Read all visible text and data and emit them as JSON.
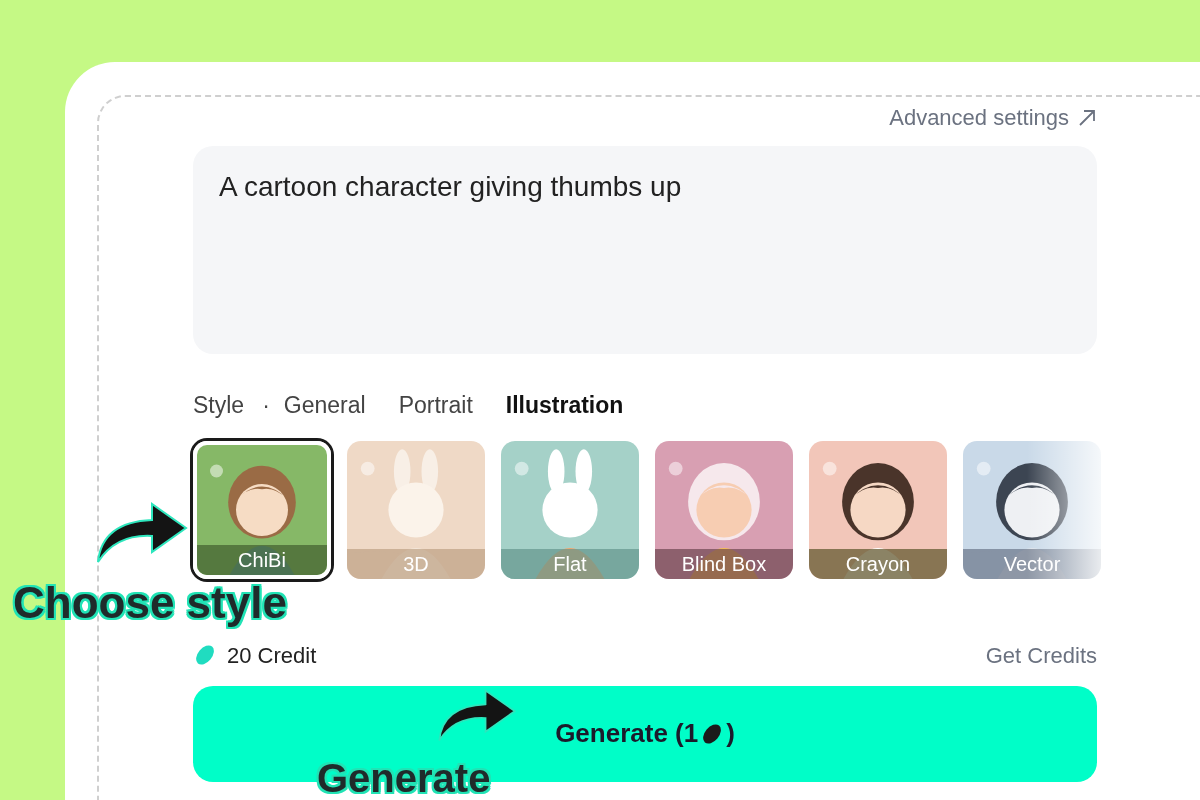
{
  "advanced_settings": {
    "label": "Advanced settings"
  },
  "prompt": {
    "value": "A cartoon character giving thumbs up"
  },
  "style_tabs": {
    "label": "Style",
    "separator": "·",
    "tabs": [
      {
        "label": "General",
        "selected": false
      },
      {
        "label": "Portrait",
        "selected": false
      },
      {
        "label": "Illustration",
        "selected": true
      }
    ]
  },
  "styles": [
    {
      "name": "ChiBi",
      "selected": true
    },
    {
      "name": "3D",
      "selected": false
    },
    {
      "name": "Flat",
      "selected": false
    },
    {
      "name": "Blind Box",
      "selected": false
    },
    {
      "name": "Crayon",
      "selected": false
    },
    {
      "name": "Vector",
      "selected": false
    }
  ],
  "credits": {
    "amount": "20 Credit",
    "link": "Get Credits"
  },
  "generate_button": {
    "label": "Generate (1",
    "label_end": ")"
  },
  "annotations": [
    {
      "text": "Choose style"
    },
    {
      "text": "Generate"
    }
  ]
}
